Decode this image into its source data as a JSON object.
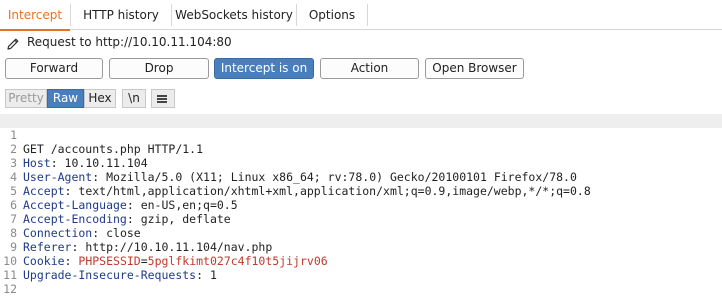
{
  "tabs": [
    {
      "label": "Intercept",
      "active": true
    },
    {
      "label": "HTTP history",
      "active": false
    },
    {
      "label": "WebSockets history",
      "active": false
    },
    {
      "label": "Options",
      "active": false
    }
  ],
  "request": {
    "icon": "pencil-icon",
    "label": "Request to http://10.10.11.104:80"
  },
  "actions": {
    "forward": "Forward",
    "drop": "Drop",
    "intercept": "Intercept is on",
    "action": "Action",
    "open_browser": "Open Browser"
  },
  "view": {
    "pretty": "Pretty",
    "raw": "Raw",
    "hex": "Hex",
    "newline": "\\n",
    "menu_icon": "hamburger-menu-icon"
  },
  "editor": {
    "lines": [
      {
        "num": "1",
        "text": "GET /accounts.php HTTP/1.1"
      },
      {
        "num": "2",
        "key": "Host",
        "value": ": 10.10.11.104"
      },
      {
        "num": "3",
        "key": "User-Agent",
        "value": ": Mozilla/5.0 (X11; Linux x86_64; rv:78.0) Gecko/20100101 Firefox/78.0"
      },
      {
        "num": "4",
        "key": "Accept",
        "value": ": text/html,application/xhtml+xml,application/xml;q=0.9,image/webp,*/*;q=0.8"
      },
      {
        "num": "5",
        "key": "Accept-Language",
        "value": ": en-US,en;q=0.5"
      },
      {
        "num": "6",
        "key": "Accept-Encoding",
        "value": ": gzip, deflate"
      },
      {
        "num": "7",
        "key": "Connection",
        "value": ": close"
      },
      {
        "num": "8",
        "key": "Referer",
        "value": ": http://10.10.11.104/nav.php"
      },
      {
        "num": "9",
        "key": "Cookie",
        "value": ": ",
        "cookie_name": "PHPSESSID",
        "cookie_eq": "=",
        "cookie_value": "5pglfkimt027c4f10t5jijrv06"
      },
      {
        "num": "10",
        "key": "Upgrade-Insecure-Requests",
        "value": ": 1"
      },
      {
        "num": "11",
        "text": ""
      },
      {
        "num": "12",
        "text": ""
      }
    ]
  },
  "colors": {
    "accent": "#e8722a",
    "selected": "#4a7fbd",
    "header_key": "#1e3a8a",
    "cookie": "#c0392b"
  }
}
